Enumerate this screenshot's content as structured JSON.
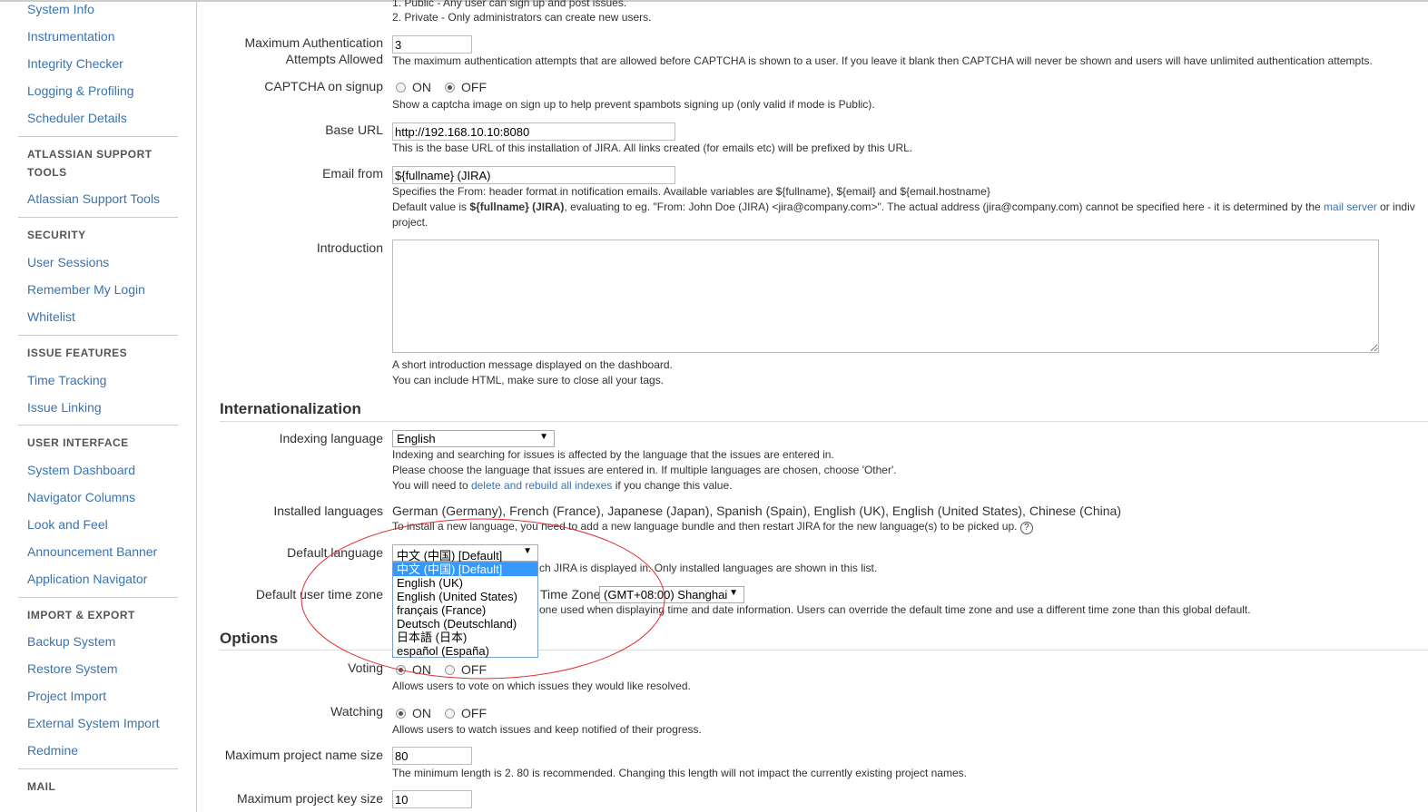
{
  "sidebar": {
    "items_top": [
      "System Info",
      "Instrumentation",
      "Integrity Checker",
      "Logging & Profiling",
      "Scheduler Details"
    ],
    "support_heading": [
      "ATLASSIAN SUPPORT",
      "TOOLS"
    ],
    "support_items": [
      "Atlassian Support Tools"
    ],
    "security_heading": "SECURITY",
    "security_items": [
      "User Sessions",
      "Remember My Login",
      "Whitelist"
    ],
    "issue_heading": "ISSUE FEATURES",
    "issue_items": [
      "Time Tracking",
      "Issue Linking"
    ],
    "ui_heading": "USER INTERFACE",
    "ui_items": [
      "System Dashboard",
      "Navigator Columns",
      "Look and Feel",
      "Announcement Banner",
      "Application Navigator"
    ],
    "import_heading": "IMPORT & EXPORT",
    "import_items": [
      "Backup System",
      "Restore System",
      "Project Import",
      "External System Import",
      "Redmine"
    ],
    "mail_heading": "MAIL"
  },
  "general": {
    "mode_line1": "1. Public - Any user can sign up and post issues.",
    "mode_line2": "2. Private - Only administrators can create new users.",
    "max_auth_label1": "Maximum Authentication",
    "max_auth_label2": "Attempts Allowed",
    "max_auth_value": "3",
    "max_auth_desc": "The maximum authentication attempts that are allowed before CAPTCHA is shown to a user. If you leave it blank then CAPTCHA will never be shown and users will have unlimited authentication attempts.",
    "captcha_label": "CAPTCHA on signup",
    "on": "ON",
    "off": "OFF",
    "captcha_desc": "Show a captcha image on sign up to help prevent spambots signing up (only valid if mode is Public).",
    "base_url_label": "Base URL",
    "base_url_value": "http://192.168.10.10:8080",
    "base_url_desc": "This is the base URL of this installation of JIRA. All links created (for emails etc) will be prefixed by this URL.",
    "email_from_label": "Email from",
    "email_from_value": "${fullname} (JIRA)",
    "email_desc1": "Specifies the From: header format in notification emails. Available variables are ${fullname}, ${email} and ${email.hostname}",
    "email_desc2a": "Default value is ",
    "email_desc2b": "${fullname} (JIRA)",
    "email_desc2c": ", evaluating to eg. \"From: John Doe (JIRA) <jira@company.com>\". The actual address (jira@company.com) cannot be specified here - it is determined by the ",
    "email_desc2_link": "mail server",
    "email_desc2d": " or indiv",
    "email_desc3": "project.",
    "intro_label": "Introduction",
    "intro_desc1": "A short introduction message displayed on the dashboard.",
    "intro_desc2": "You can include HTML, make sure to close all your tags."
  },
  "i18n": {
    "heading": "Internationalization",
    "indexing_label": "Indexing language",
    "indexing_value": "English",
    "indexing_desc1": "Indexing and searching for issues is affected by the language that the issues are entered in.",
    "indexing_desc2": "Please choose the language that issues are entered in. If multiple languages are chosen, choose 'Other'.",
    "indexing_desc3a": "You will need to ",
    "indexing_desc3_link": "delete and rebuild all indexes",
    "indexing_desc3b": " if you change this value.",
    "installed_label": "Installed languages",
    "installed_value": "German (Germany), French (France), Japanese (Japan), Spanish (Spain), English (UK), English (United States), Chinese (China)",
    "installed_desc": "To install a new language, you need to add a new language bundle and then restart JIRA for the new language(s) to be picked up.",
    "default_lang_label": "Default language",
    "default_lang_value": "中文 (中国) [Default]",
    "default_lang_desc": "ch JIRA is displayed in. Only installed languages are shown in this list.",
    "lang_options": [
      "中文 (中国) [Default]",
      "English (UK)",
      "English (United States)",
      "français (France)",
      "Deutsch (Deutschland)",
      "日本語 (日本)",
      "español (España)"
    ],
    "tz_label": "Default user time zone",
    "tz_prefix": "Time Zone",
    "tz_value": "(GMT+08:00) Shanghai",
    "tz_desc": "one used when displaying time and date information. Users can override the default time zone and use a different time zone than this global default."
  },
  "options": {
    "heading": "Options",
    "voting_label": "Voting",
    "voting_desc": "Allows users to vote on which issues they would like resolved.",
    "watching_label": "Watching",
    "watching_desc": "Allows users to watch issues and keep notified of their progress.",
    "proj_name_label": "Maximum project name size",
    "proj_name_value": "80",
    "proj_name_desc": "The minimum length is 2. 80 is recommended. Changing this length will not impact the currently existing project names.",
    "proj_key_label": "Maximum project key size",
    "proj_key_value": "10"
  },
  "annotation_color": "#e03030"
}
